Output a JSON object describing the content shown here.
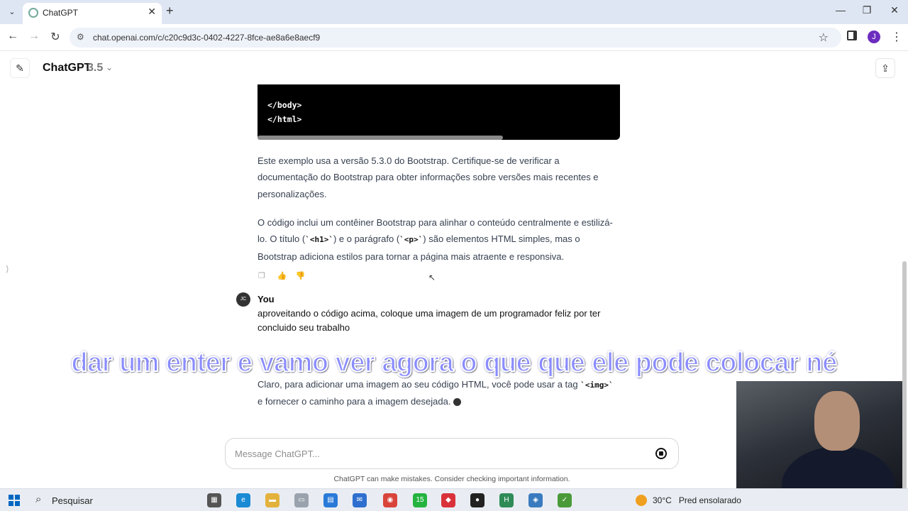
{
  "browser": {
    "tab_title": "ChatGPT",
    "url": "chat.openai.com/c/c20c9d3c-0402-4227-8fce-ae8a6e8aecf9",
    "profile_initial": "J"
  },
  "header": {
    "model_name": "ChatGPT",
    "model_version": "3.5"
  },
  "code_block": {
    "lines": [
      "</body>",
      "</html>"
    ]
  },
  "assistant": {
    "para1": "Este exemplo usa a versão 5.3.0 do Bootstrap. Certifique-se de verificar a documentação do Bootstrap para obter informações sobre versões mais recentes e personalizações.",
    "para2_a": "O código inclui um contêiner Bootstrap para alinhar o conteúdo centralmente e estilizá-lo. O título (",
    "para2_code1": "`<h1>`",
    "para2_b": ") e o parágrafo (",
    "para2_code2": "`<p>`",
    "para2_c": ") são elementos HTML simples, mas o Bootstrap adiciona estilos para tornar a página mais atraente e responsiva.",
    "reply_a": "Claro, para adicionar uma imagem ao seu código HTML, você pode usar a tag ",
    "reply_code": "`<img>`",
    "reply_b": " e fornecer o caminho para a imagem desejada."
  },
  "user": {
    "avatar_initials": "JC",
    "name": "You",
    "message": "aproveitando o código acima, coloque uma imagem de um programador feliz por ter concluido seu trabalho"
  },
  "subtitle": "dar um enter e vamo ver agora o que que ele pode colocar né",
  "composer": {
    "placeholder": "Message ChatGPT...",
    "disclaimer": "ChatGPT can make mistakes. Consider checking important information."
  },
  "taskbar": {
    "search_label": "Pesquisar",
    "weather_temp": "30°C",
    "weather_desc": "Pred ensolarado",
    "app_badge": "15"
  }
}
